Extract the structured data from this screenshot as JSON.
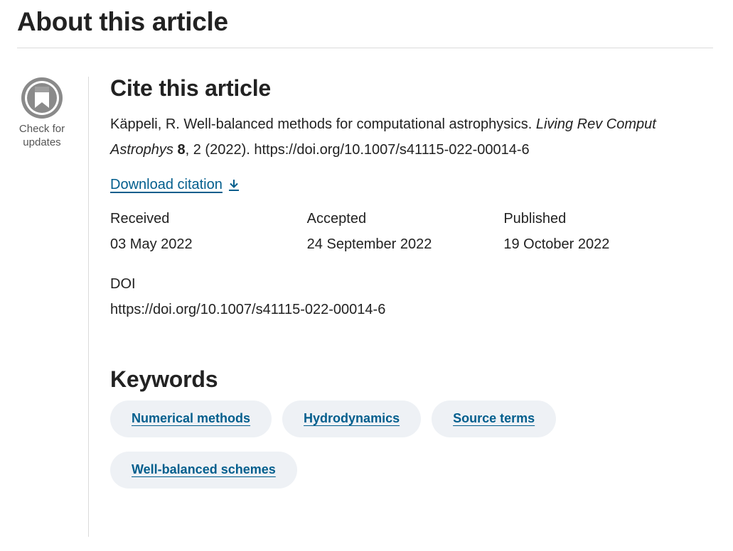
{
  "header": {
    "title": "About this article"
  },
  "badge": {
    "text_line1": "Check for",
    "text_line2": "updates"
  },
  "cite": {
    "heading": "Cite this article",
    "author_title": "Käppeli, R. Well-balanced methods for computational astrophysics. ",
    "journal": "Living Rev Comput Astrophys",
    "volume": "8",
    "issue_year": ", 2 (2022). https://doi.org/10.1007/s41115-022-00014-6",
    "download_label": "Download citation"
  },
  "dates": {
    "received_label": "Received",
    "received_value": "03 May 2022",
    "accepted_label": "Accepted",
    "accepted_value": "24 September 2022",
    "published_label": "Published",
    "published_value": "19 October 2022"
  },
  "doi": {
    "label": "DOI",
    "value": "https://doi.org/10.1007/s41115-022-00014-6"
  },
  "keywords": {
    "heading": "Keywords",
    "items": [
      "Numerical methods",
      "Hydrodynamics",
      "Source terms",
      "Well-balanced schemes"
    ]
  },
  "colors": {
    "link": "#025e8d",
    "chip_bg": "#eef1f5",
    "rule": "#dadada",
    "text": "#222222"
  }
}
